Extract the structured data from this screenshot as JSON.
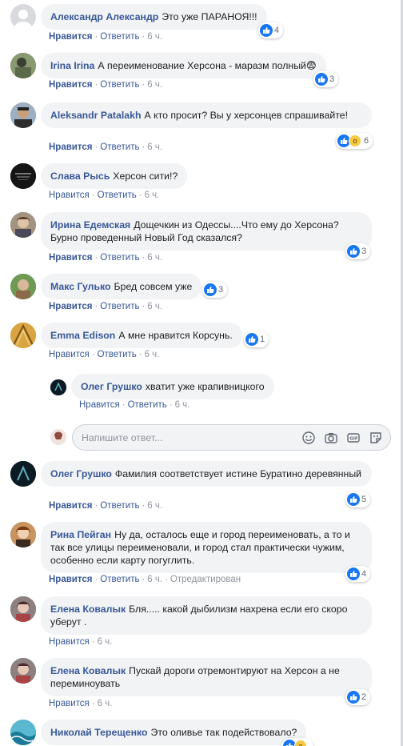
{
  "ui": {
    "like": "Нравится",
    "reply": "Ответить",
    "edited": "Отредактирован",
    "dot": "·",
    "reply_placeholder": "Напишите ответ..."
  },
  "comments": [
    {
      "author": "Александр Александр",
      "text": "Это уже ПАРАНОЯ!!!",
      "time": "6 ч.",
      "reactions": "4"
    },
    {
      "author": "Irina Irina",
      "text": "А переименование Херсона - маразм полный",
      "time": "6 ч.",
      "reactions": "3",
      "emoji": "😨"
    },
    {
      "author": "Aleksandr Patalakh",
      "text": "А кто просит? Вы у херсонцев спрашивайте!",
      "time": "6 ч.",
      "reactions": "6"
    },
    {
      "author": "Слава Рысь",
      "text": "Херсон сити!?",
      "time": "6 ч.",
      "reactions": ""
    },
    {
      "author": "Ирина Едемская",
      "text": "Дощечкин из Одессы....Что ему до Херсона? Бурно проведенный Новый Год сказался?",
      "time": "6 ч.",
      "reactions": "3"
    },
    {
      "author": "Макс Гулько",
      "text": "Бред совсем уже",
      "time": "6 ч.",
      "reactions": "3"
    },
    {
      "author": "Emma Edison",
      "text": "А мне нравится Корсунь.",
      "time": "6 ч.",
      "reactions": "1"
    },
    {
      "author": "Олег Грушко",
      "text": "хватит уже крапивницкого",
      "time": "6 ч.",
      "reactions": ""
    },
    {
      "author": "Олег Грушко",
      "text": "Фамилия соответствует истине Буратино деревянный",
      "time": "6 ч.",
      "reactions": "5"
    },
    {
      "author": "Рина Пейган",
      "text": "Ну да, осталось еще и город переименовать, а то и так все улицы переименовали, и город стал практически чужим, особенно если карту погуглить.",
      "time": "6 ч.",
      "reactions": "4"
    },
    {
      "author": "Елена Ковалык",
      "text": "Бля..... какой дыбилизм нахрена если его скоро уберут .",
      "time": "6 ч.",
      "reactions": ""
    },
    {
      "author": "Елена Ковалык",
      "text": "Пускай дороги отремонтируют на Херсон а не переминоувать",
      "time": "6 ч.",
      "reactions": "2"
    },
    {
      "author": "Николай Терещенко",
      "text": "Это оливье так подействовало?",
      "time": "",
      "reactions": ""
    }
  ]
}
